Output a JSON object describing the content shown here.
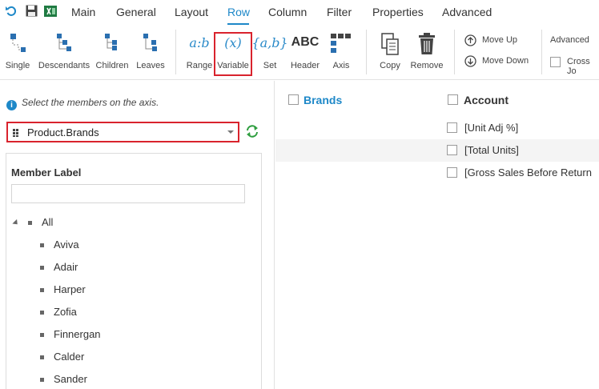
{
  "menu": {
    "items": [
      {
        "label": "Main"
      },
      {
        "label": "General"
      },
      {
        "label": "Layout"
      },
      {
        "label": "Row"
      },
      {
        "label": "Column"
      },
      {
        "label": "Filter"
      },
      {
        "label": "Properties"
      },
      {
        "label": "Advanced"
      }
    ],
    "active": "Row"
  },
  "ribbon": {
    "single": "Single",
    "descendants": "Descendants",
    "children": "Children",
    "leaves": "Leaves",
    "range": "Range",
    "range_glyph": "a:b",
    "variable": "Variable",
    "variable_glyph": "(x)",
    "set": "Set",
    "set_glyph": "{a,b}",
    "header": "Header",
    "header_glyph": "ABC",
    "axis": "Axis",
    "copy": "Copy",
    "remove": "Remove",
    "move_up": "Move Up",
    "move_down": "Move Down",
    "advanced_title": "Advanced",
    "cross_join": "Cross Jo"
  },
  "left": {
    "info": "Select the members on the axis.",
    "dropdown_value": "Product.Brands",
    "member_label": "Member Label",
    "member_search_value": "",
    "tree_root": "All",
    "members": [
      "Aviva",
      "Adair",
      "Harper",
      "Zofia",
      "Finnergan",
      "Calder",
      "Sander"
    ]
  },
  "right": {
    "columns": [
      "Brands",
      "Account"
    ],
    "accounts": [
      "[Unit Adj %]",
      "[Total Units]",
      "[Gross Sales Before Return"
    ]
  },
  "colors": {
    "accent": "#1e88c8",
    "highlight": "#d9232d",
    "refresh": "#2e9e3f"
  }
}
